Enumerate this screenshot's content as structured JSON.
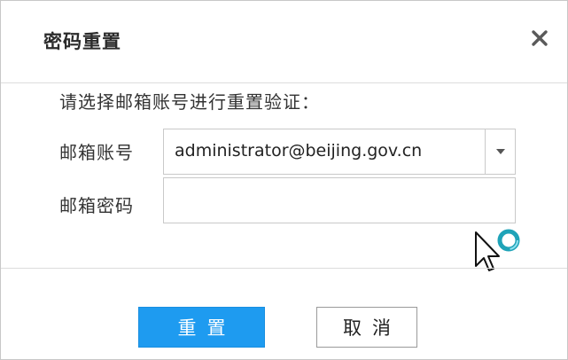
{
  "dialog": {
    "title": "密码重置",
    "close_icon": "close-icon"
  },
  "form": {
    "prompt": "请选择邮箱账号进行重置验证：",
    "account_label": "邮箱账号",
    "account_value": "administrator@beijing.gov.cn",
    "password_label": "邮箱密码",
    "password_value": "",
    "dropdown_icon": "chevron-down-icon"
  },
  "buttons": {
    "reset_label": "重置",
    "cancel_label": "取消"
  },
  "colors": {
    "primary": "#1e9bf0",
    "text": "#333333",
    "border": "#c9c9c9"
  },
  "cursor": {
    "icon": "busy-cursor-icon"
  }
}
